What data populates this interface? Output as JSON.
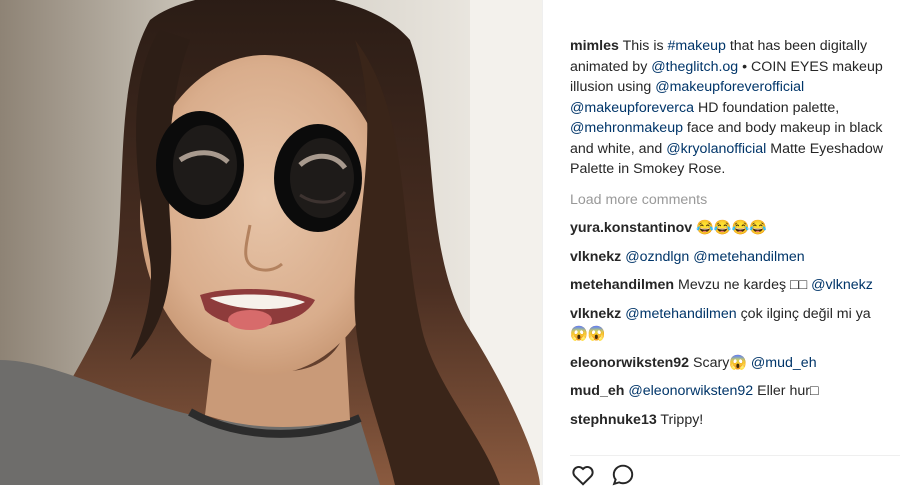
{
  "post": {
    "author": "mimles",
    "caption_parts": [
      {
        "t": "This is ",
        "link": false
      },
      {
        "t": "#makeup",
        "link": true
      },
      {
        "t": " that has been digitally animated by ",
        "link": false
      },
      {
        "t": "@theglitch.og",
        "link": true
      },
      {
        "t": " • COIN EYES makeup illusion using ",
        "link": false
      },
      {
        "t": "@makeupforeverofficial",
        "link": true
      },
      {
        "t": " ",
        "link": false
      },
      {
        "t": "@makeupforeverca",
        "link": true
      },
      {
        "t": " HD foundation palette, ",
        "link": false
      },
      {
        "t": "@mehronmakeup",
        "link": true
      },
      {
        "t": " face and body makeup in black and white, and ",
        "link": false
      },
      {
        "t": "@kryolanofficial",
        "link": true
      },
      {
        "t": " Matte Eyeshadow Palette in Smokey Rose.",
        "link": false
      }
    ]
  },
  "load_more_label": "Load more comments",
  "comments": [
    {
      "user": "yura.konstantinov",
      "parts": [
        {
          "t": " 😂😂😂😂",
          "link": false
        }
      ]
    },
    {
      "user": "vlknekz",
      "parts": [
        {
          "t": " ",
          "link": false
        },
        {
          "t": "@ozndlgn",
          "link": true
        },
        {
          "t": " ",
          "link": false
        },
        {
          "t": "@metehandilmen",
          "link": true
        }
      ]
    },
    {
      "user": "metehandilmen",
      "parts": [
        {
          "t": " Mevzu ne kardeş □□ ",
          "link": false
        },
        {
          "t": "@vlknekz",
          "link": true
        }
      ]
    },
    {
      "user": "vlknekz",
      "parts": [
        {
          "t": " ",
          "link": false
        },
        {
          "t": "@metehandilmen",
          "link": true
        },
        {
          "t": " çok ilginç değil mi ya 😱😱",
          "link": false
        }
      ]
    },
    {
      "user": "eleonorwiksten92",
      "parts": [
        {
          "t": " Scary😱 ",
          "link": false
        },
        {
          "t": "@mud_eh",
          "link": true
        }
      ]
    },
    {
      "user": "mud_eh",
      "parts": [
        {
          "t": " ",
          "link": false
        },
        {
          "t": "@eleonorwiksten92",
          "link": true
        },
        {
          "t": " Eller hur□",
          "link": false
        }
      ]
    },
    {
      "user": "stephnuke13",
      "parts": [
        {
          "t": " Trippy!",
          "link": false
        }
      ]
    }
  ],
  "icons": {
    "like": "heart-icon",
    "comment": "comment-icon"
  },
  "colors": {
    "link": "#003569",
    "muted": "#999999",
    "text": "#262626"
  }
}
